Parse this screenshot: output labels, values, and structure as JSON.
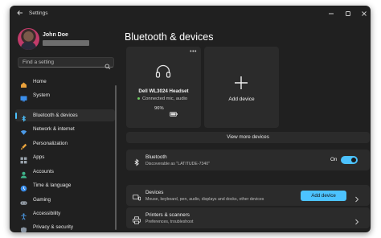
{
  "window": {
    "title": "Settings"
  },
  "profile": {
    "name": "John Doe"
  },
  "search": {
    "placeholder": "Find a setting"
  },
  "sidebar": {
    "items": [
      {
        "label": "Home",
        "icon": "home-icon"
      },
      {
        "label": "System",
        "icon": "monitor-icon"
      },
      {
        "label": "Bluetooth & devices",
        "icon": "bluetooth-icon",
        "selected": true
      },
      {
        "label": "Network & internet",
        "icon": "wifi-icon"
      },
      {
        "label": "Personalization",
        "icon": "brush-icon"
      },
      {
        "label": "Apps",
        "icon": "apps-icon"
      },
      {
        "label": "Accounts",
        "icon": "person-icon"
      },
      {
        "label": "Time & language",
        "icon": "globe-clock-icon"
      },
      {
        "label": "Gaming",
        "icon": "gamepad-icon"
      },
      {
        "label": "Accessibility",
        "icon": "accessibility-icon"
      },
      {
        "label": "Privacy & security",
        "icon": "shield-icon"
      }
    ]
  },
  "main": {
    "title": "Bluetooth & devices",
    "device_card": {
      "name": "Dell WL3024 Headset",
      "status": "Connected mic, audio",
      "battery": "96%"
    },
    "add_card": {
      "label": "Add device"
    },
    "view_more": "View more devices",
    "bluetooth_row": {
      "title": "Bluetooth",
      "subtitle": "Discoverable as \"LATITUDE-7340\"",
      "toggle_label": "On",
      "toggle_on": true
    },
    "devices_row": {
      "title": "Devices",
      "subtitle": "Mouse, keyboard, pen, audio, displays and docks, other devices",
      "button_label": "Add device"
    },
    "printers_row": {
      "title": "Printers & scanners",
      "subtitle": "Preferences, troubleshoot"
    }
  },
  "colors": {
    "accent": "#4cc2ff",
    "background": "#202020",
    "card": "#2b2b2b",
    "status_green": "#6ccb5f"
  }
}
